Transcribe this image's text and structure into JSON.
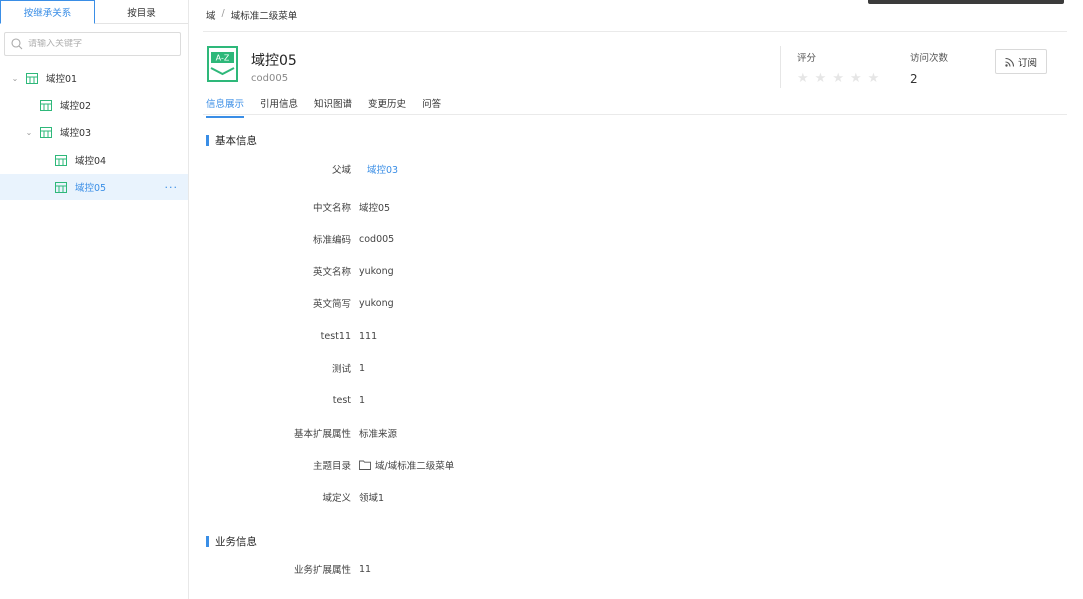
{
  "sidebar": {
    "tabs": [
      {
        "label": "按继承关系"
      },
      {
        "label": "按目录"
      }
    ],
    "search_placeholder": "请输入关键字",
    "tree": [
      {
        "label": "域控01"
      },
      {
        "label": "域控02"
      },
      {
        "label": "域控03"
      },
      {
        "label": "域控04"
      },
      {
        "label": "域控05"
      }
    ],
    "more": "···"
  },
  "breadcrumb": {
    "root": "域",
    "separator": "/",
    "current": "域标准二级菜单"
  },
  "header": {
    "icon_text": "A-Z",
    "title": "域控05",
    "code": "cod005",
    "rating_label": "评分",
    "rating": 0,
    "rating_max": 5,
    "visits_label": "访问次数",
    "visits": "2",
    "subscribe_label": "订阅"
  },
  "tabs": [
    {
      "label": "信息展示"
    },
    {
      "label": "引用信息"
    },
    {
      "label": "知识图谱"
    },
    {
      "label": "变更历史"
    },
    {
      "label": "问答"
    }
  ],
  "basic_info": {
    "title": "基本信息",
    "fields": [
      {
        "label": "父域",
        "value": "域控03"
      },
      {
        "label": "中文名称",
        "value": "域控05"
      },
      {
        "label": "标准编码",
        "value": "cod005"
      },
      {
        "label": "英文名称",
        "value": "yukong"
      },
      {
        "label": "英文简写",
        "value": "yukong"
      },
      {
        "label": "test11",
        "value": "111"
      },
      {
        "label": "测试",
        "value": "1"
      },
      {
        "label": "test",
        "value": "1"
      },
      {
        "label": "基本扩展属性",
        "value": "标准来源"
      },
      {
        "label": "主题目录",
        "value": "域/域标准二级菜单"
      },
      {
        "label": "域定义",
        "value": "领域1"
      }
    ]
  },
  "business_info": {
    "title": "业务信息",
    "fields": [
      {
        "label": "业务扩展属性",
        "value": "11"
      }
    ]
  },
  "colors": {
    "accent": "#3a8ee6",
    "icon_green": "#2eb87a"
  }
}
